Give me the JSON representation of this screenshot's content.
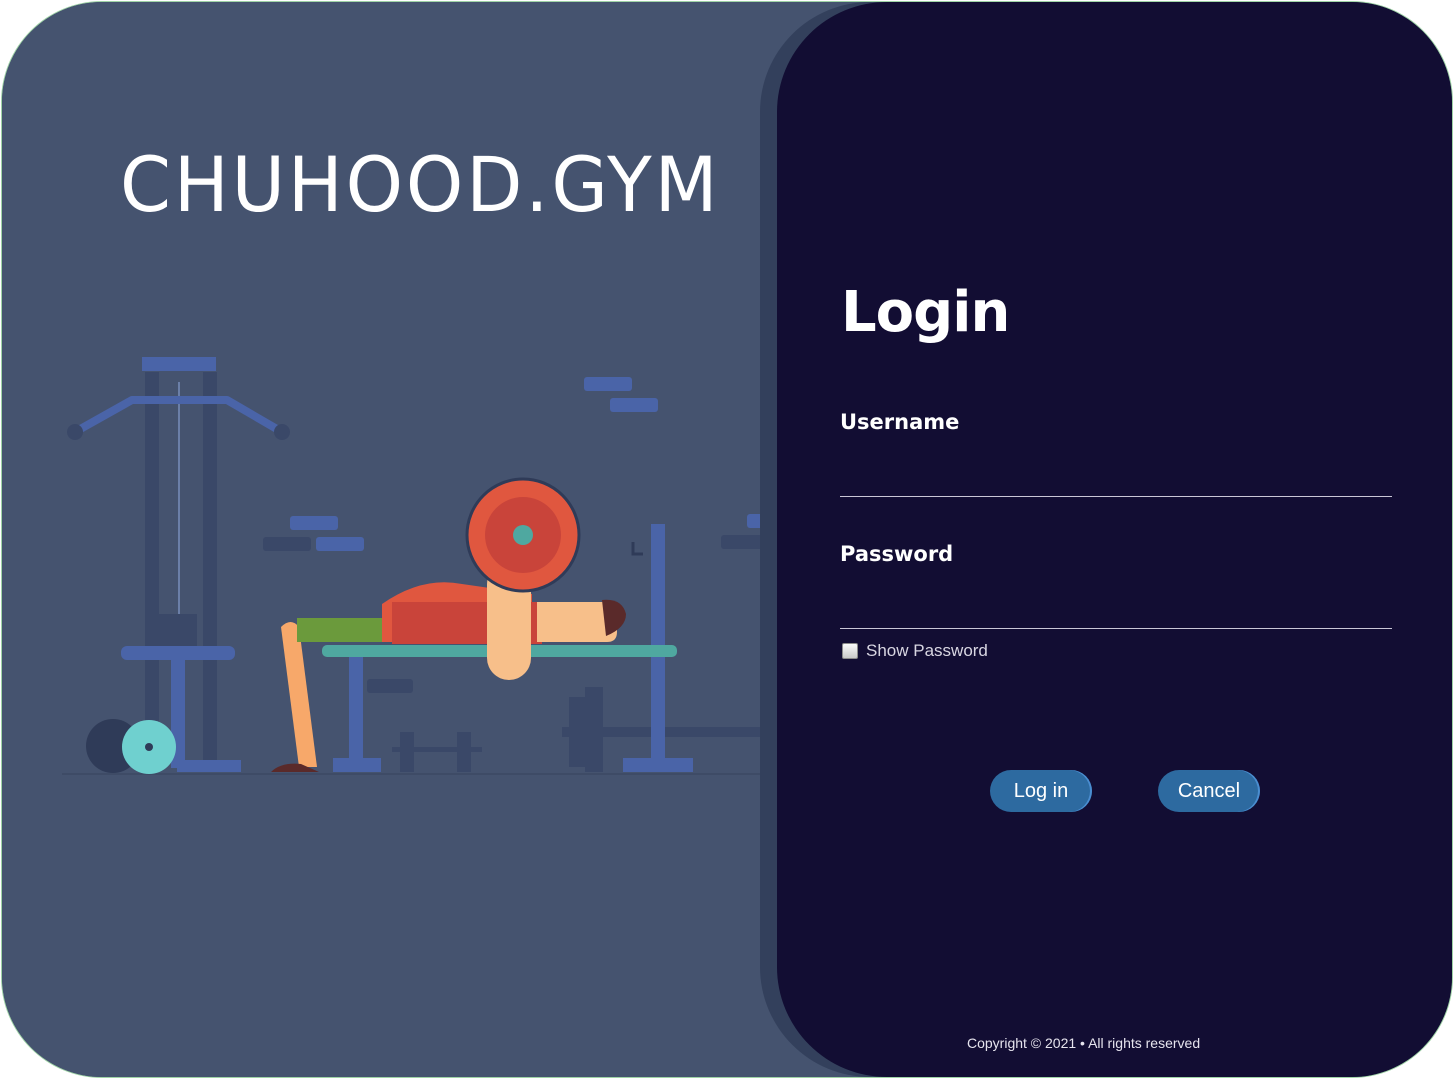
{
  "brand": {
    "name": "CHUHOOD.GYM"
  },
  "login": {
    "title": "Login",
    "username_label": "Username",
    "username_value": "",
    "password_label": "Password",
    "password_value": "",
    "show_password_label": "Show Password",
    "show_password_checked": false,
    "login_button": "Log in",
    "cancel_button": "Cancel"
  },
  "footer": {
    "copyright": "Copyright © 2021 • All rights reserved"
  },
  "colors": {
    "left_background": "#45536f",
    "right_background": "#120d33",
    "button": "#2d6aa0",
    "barbell_plate": "#e0573f",
    "plate_small": "#6fd0cf"
  },
  "illustration": {
    "subject": "person-bench-press-gym-illustration"
  }
}
